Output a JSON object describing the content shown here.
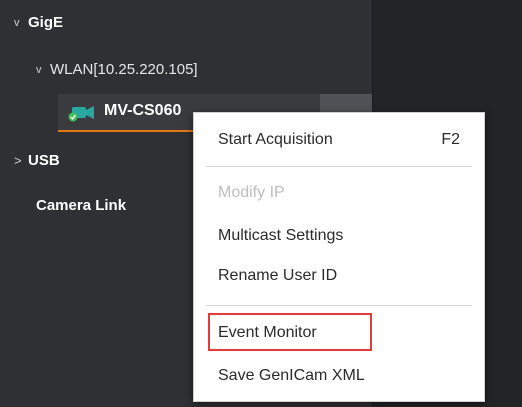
{
  "tree": {
    "gige": {
      "label": "GigE",
      "chevron": "v"
    },
    "wlan": {
      "label": "WLAN[10.25.220.105]",
      "chevron": "v"
    },
    "device": {
      "label": "MV-CS060",
      "icon": "camera-icon"
    },
    "usb": {
      "label": "USB",
      "chevron": ">"
    },
    "camera_link": {
      "label": "Camera Link"
    }
  },
  "context_menu": {
    "items": [
      {
        "label": "Start Acquisition",
        "shortcut": "F2",
        "enabled": true
      },
      {
        "label": "Modify IP",
        "shortcut": "",
        "enabled": false
      },
      {
        "label": "Multicast Settings",
        "shortcut": "",
        "enabled": true
      },
      {
        "label": "Rename User ID",
        "shortcut": "",
        "enabled": true
      },
      {
        "label": "Event Monitor",
        "shortcut": "",
        "enabled": true,
        "highlighted": true
      },
      {
        "label": "Save GenICam XML",
        "shortcut": "",
        "enabled": true
      }
    ]
  },
  "colors": {
    "background": "#2f3033",
    "selection_underline": "#e07a12",
    "highlight_box": "#e23b3b",
    "status_ok": "#3fbf5a",
    "camera_teal": "#2aa8a0"
  }
}
